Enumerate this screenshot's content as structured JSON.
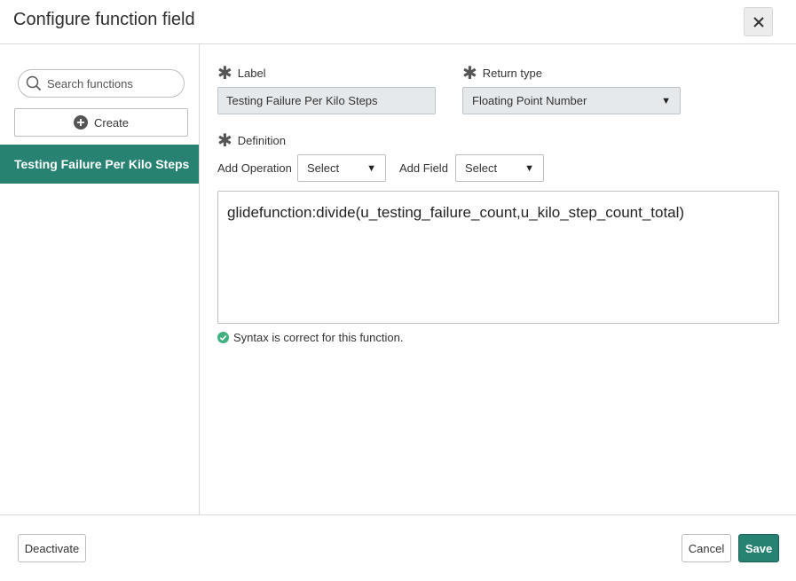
{
  "header": {
    "title": "Configure function field",
    "close_icon": "close-icon"
  },
  "sidebar": {
    "search_placeholder": "Search functions",
    "create_label": "Create",
    "items": [
      {
        "label": "Testing Failure Per Kilo Steps",
        "selected": true
      }
    ]
  },
  "form": {
    "label_title": "Label",
    "label_value": "Testing Failure Per Kilo Steps",
    "return_type_title": "Return type",
    "return_type_value": "Floating Point Number",
    "definition_title": "Definition",
    "add_operation_label": "Add Operation",
    "add_operation_value": "Select",
    "add_field_label": "Add Field",
    "add_field_value": "Select",
    "definition_value": "glidefunction:divide(u_testing_failure_count,u_kilo_step_count_total)",
    "syntax_message": "Syntax is correct for this function."
  },
  "footer": {
    "deactivate_label": "Deactivate",
    "cancel_label": "Cancel",
    "save_label": "Save"
  },
  "colors": {
    "accent": "#278272",
    "success": "#3fb07f"
  }
}
